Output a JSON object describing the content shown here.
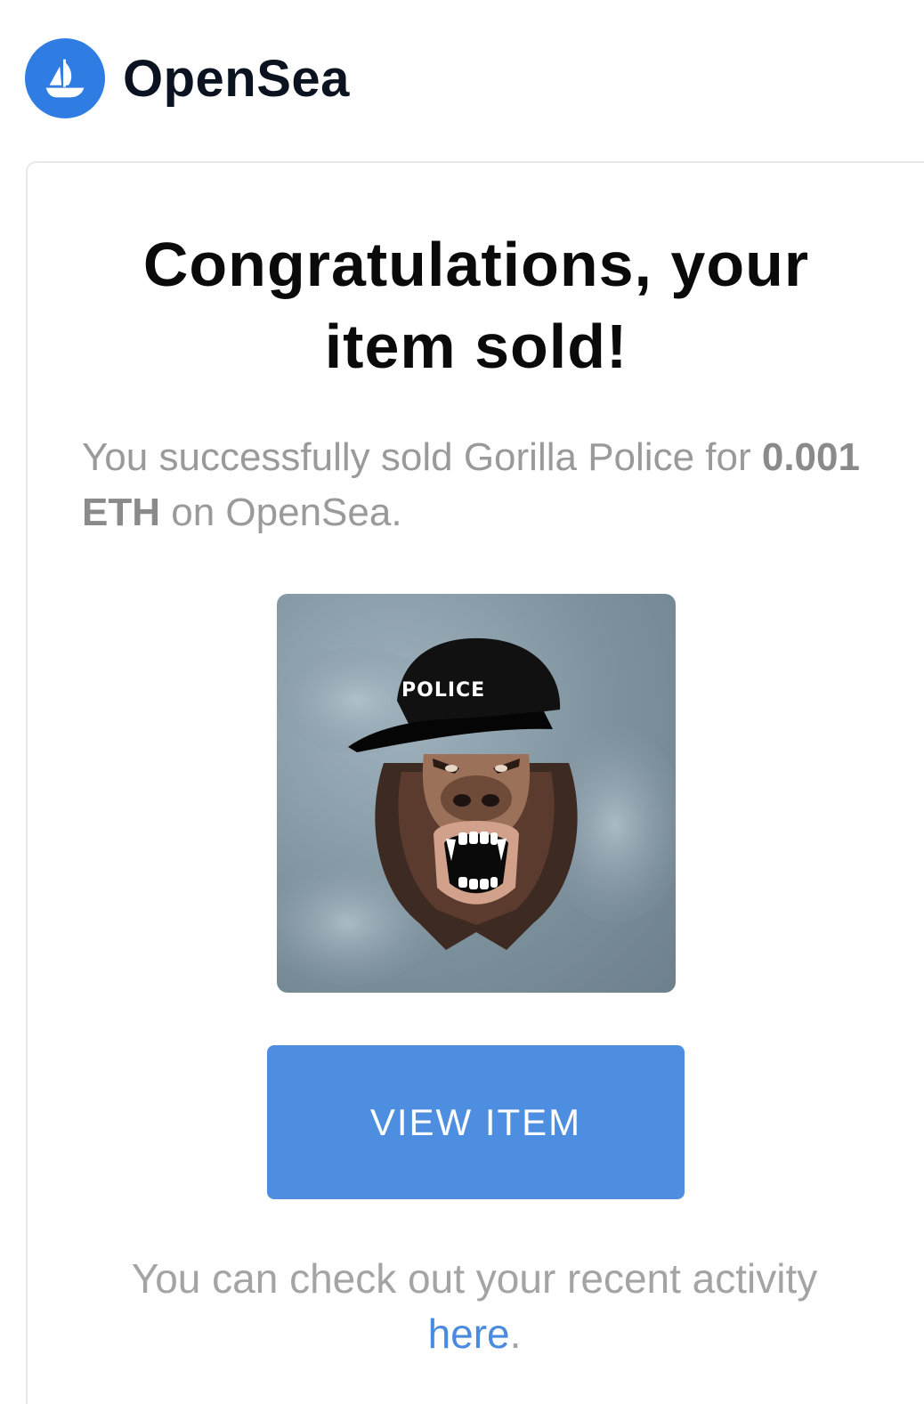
{
  "brand": {
    "name": "OpenSea",
    "logo_icon": "opensea-boat-icon",
    "logo_color": "#2f7de2"
  },
  "email": {
    "title_line1": "Congratulations, your",
    "title_line2": "item sold!",
    "lead_prefix": "You successfully sold Gorilla Police for",
    "lead_price": "0.001 ETH",
    "lead_suffix": "on OpenSea.",
    "image": {
      "icon": "gorilla-police-nft-image",
      "cap_text": "POLICE"
    },
    "button_label": "VIEW ITEM",
    "footer_prefix": "You can check out your recent activity",
    "footer_link": "here",
    "footer_suffix": "."
  },
  "colors": {
    "accent": "#4e8ee0",
    "link": "#4a8be0",
    "muted_text": "#9a9a9a"
  }
}
